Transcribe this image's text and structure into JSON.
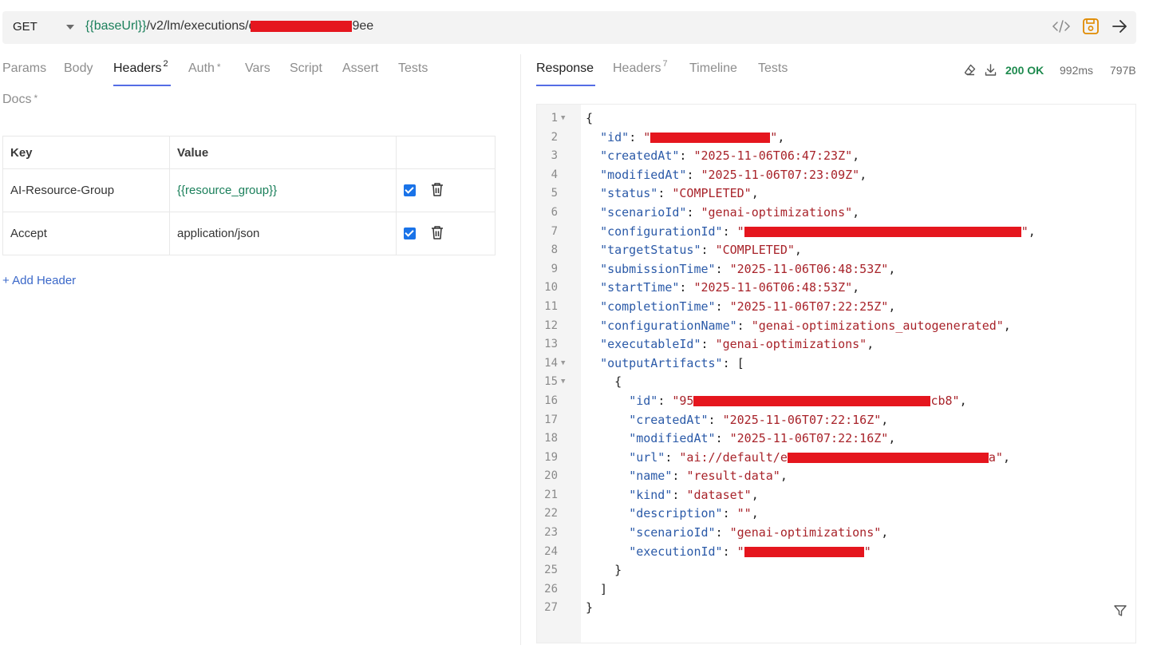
{
  "request": {
    "method": "GET",
    "url_var": "{{baseUrl}}",
    "url_path": "/v2/lm/executions/e",
    "url_suffix": "9ee"
  },
  "left_tabs": [
    {
      "label": "Params"
    },
    {
      "label": "Body"
    },
    {
      "label": "Headers",
      "count": "2",
      "active": true
    },
    {
      "label": "Auth",
      "marker": "*"
    },
    {
      "label": "Vars"
    },
    {
      "label": "Script"
    },
    {
      "label": "Assert"
    },
    {
      "label": "Tests"
    },
    {
      "label": "Docs",
      "marker": "*"
    }
  ],
  "headers_table": {
    "columns": [
      "Key",
      "Value",
      ""
    ],
    "rows": [
      {
        "key": "AI-Resource-Group",
        "value": "{{resource_group}}",
        "enabled": true
      },
      {
        "key": "Accept",
        "value": "application/json",
        "enabled": true
      }
    ],
    "add_label": "+ Add Header"
  },
  "response_tabs": [
    {
      "label": "Response",
      "active": true
    },
    {
      "label": "Headers",
      "count": "7"
    },
    {
      "label": "Timeline"
    },
    {
      "label": "Tests"
    }
  ],
  "response_meta": {
    "status": "200 OK",
    "time": "992ms",
    "size": "797B"
  },
  "response_lines": [
    {
      "n": "1",
      "fold": true,
      "parts": [
        [
          "p",
          "{"
        ]
      ]
    },
    {
      "n": "2",
      "parts": [
        [
          "p",
          "  "
        ],
        [
          "k",
          "\"id\""
        ],
        [
          "p",
          ": "
        ],
        [
          "s",
          "\""
        ],
        [
          "r",
          ""
        ],
        [
          "s",
          "\""
        ],
        [
          "p",
          ","
        ]
      ]
    },
    {
      "n": "3",
      "parts": [
        [
          "p",
          "  "
        ],
        [
          "k",
          "\"createdAt\""
        ],
        [
          "p",
          ": "
        ],
        [
          "s",
          "\"2025-11-06T06:47:23Z\""
        ],
        [
          "p",
          ","
        ]
      ]
    },
    {
      "n": "4",
      "parts": [
        [
          "p",
          "  "
        ],
        [
          "k",
          "\"modifiedAt\""
        ],
        [
          "p",
          ": "
        ],
        [
          "s",
          "\"2025-11-06T07:23:09Z\""
        ],
        [
          "p",
          ","
        ]
      ]
    },
    {
      "n": "5",
      "parts": [
        [
          "p",
          "  "
        ],
        [
          "k",
          "\"status\""
        ],
        [
          "p",
          ": "
        ],
        [
          "s",
          "\"COMPLETED\""
        ],
        [
          "p",
          ","
        ]
      ]
    },
    {
      "n": "6",
      "parts": [
        [
          "p",
          "  "
        ],
        [
          "k",
          "\"scenarioId\""
        ],
        [
          "p",
          ": "
        ],
        [
          "s",
          "\"genai-optimizations\""
        ],
        [
          "p",
          ","
        ]
      ]
    },
    {
      "n": "7",
      "parts": [
        [
          "p",
          "  "
        ],
        [
          "k",
          "\"configurationId\""
        ],
        [
          "p",
          ": "
        ],
        [
          "s",
          "\""
        ],
        [
          "r",
          ""
        ],
        [
          "s",
          "\""
        ],
        [
          "p",
          ","
        ]
      ]
    },
    {
      "n": "8",
      "parts": [
        [
          "p",
          "  "
        ],
        [
          "k",
          "\"targetStatus\""
        ],
        [
          "p",
          ": "
        ],
        [
          "s",
          "\"COMPLETED\""
        ],
        [
          "p",
          ","
        ]
      ]
    },
    {
      "n": "9",
      "parts": [
        [
          "p",
          "  "
        ],
        [
          "k",
          "\"submissionTime\""
        ],
        [
          "p",
          ": "
        ],
        [
          "s",
          "\"2025-11-06T06:48:53Z\""
        ],
        [
          "p",
          ","
        ]
      ]
    },
    {
      "n": "10",
      "parts": [
        [
          "p",
          "  "
        ],
        [
          "k",
          "\"startTime\""
        ],
        [
          "p",
          ": "
        ],
        [
          "s",
          "\"2025-11-06T06:48:53Z\""
        ],
        [
          "p",
          ","
        ]
      ]
    },
    {
      "n": "11",
      "parts": [
        [
          "p",
          "  "
        ],
        [
          "k",
          "\"completionTime\""
        ],
        [
          "p",
          ": "
        ],
        [
          "s",
          "\"2025-11-06T07:22:25Z\""
        ],
        [
          "p",
          ","
        ]
      ]
    },
    {
      "n": "12",
      "parts": [
        [
          "p",
          "  "
        ],
        [
          "k",
          "\"configurationName\""
        ],
        [
          "p",
          ": "
        ],
        [
          "s",
          "\"genai-optimizations_autogenerated\""
        ],
        [
          "p",
          ","
        ]
      ]
    },
    {
      "n": "13",
      "parts": [
        [
          "p",
          "  "
        ],
        [
          "k",
          "\"executableId\""
        ],
        [
          "p",
          ": "
        ],
        [
          "s",
          "\"genai-optimizations\""
        ],
        [
          "p",
          ","
        ]
      ]
    },
    {
      "n": "14",
      "fold": true,
      "parts": [
        [
          "p",
          "  "
        ],
        [
          "k",
          "\"outputArtifacts\""
        ],
        [
          "p",
          ": ["
        ]
      ]
    },
    {
      "n": "15",
      "fold": true,
      "parts": [
        [
          "p",
          "    {"
        ]
      ]
    },
    {
      "n": "16",
      "parts": [
        [
          "p",
          "      "
        ],
        [
          "k",
          "\"id\""
        ],
        [
          "p",
          ": "
        ],
        [
          "s",
          "\"95"
        ],
        [
          "r",
          ""
        ],
        [
          "s",
          "cb8\""
        ],
        [
          "p",
          ","
        ]
      ]
    },
    {
      "n": "17",
      "parts": [
        [
          "p",
          "      "
        ],
        [
          "k",
          "\"createdAt\""
        ],
        [
          "p",
          ": "
        ],
        [
          "s",
          "\"2025-11-06T07:22:16Z\""
        ],
        [
          "p",
          ","
        ]
      ]
    },
    {
      "n": "18",
      "parts": [
        [
          "p",
          "      "
        ],
        [
          "k",
          "\"modifiedAt\""
        ],
        [
          "p",
          ": "
        ],
        [
          "s",
          "\"2025-11-06T07:22:16Z\""
        ],
        [
          "p",
          ","
        ]
      ]
    },
    {
      "n": "19",
      "parts": [
        [
          "p",
          "      "
        ],
        [
          "k",
          "\"url\""
        ],
        [
          "p",
          ": "
        ],
        [
          "s",
          "\"ai://default/e"
        ],
        [
          "r",
          ""
        ],
        [
          "s",
          "a\""
        ],
        [
          "p",
          ","
        ]
      ]
    },
    {
      "n": "20",
      "parts": [
        [
          "p",
          "      "
        ],
        [
          "k",
          "\"name\""
        ],
        [
          "p",
          ": "
        ],
        [
          "s",
          "\"result-data\""
        ],
        [
          "p",
          ","
        ]
      ]
    },
    {
      "n": "21",
      "parts": [
        [
          "p",
          "      "
        ],
        [
          "k",
          "\"kind\""
        ],
        [
          "p",
          ": "
        ],
        [
          "s",
          "\"dataset\""
        ],
        [
          "p",
          ","
        ]
      ]
    },
    {
      "n": "22",
      "parts": [
        [
          "p",
          "      "
        ],
        [
          "k",
          "\"description\""
        ],
        [
          "p",
          ": "
        ],
        [
          "s",
          "\"\""
        ],
        [
          "p",
          ","
        ]
      ]
    },
    {
      "n": "23",
      "parts": [
        [
          "p",
          "      "
        ],
        [
          "k",
          "\"scenarioId\""
        ],
        [
          "p",
          ": "
        ],
        [
          "s",
          "\"genai-optimizations\""
        ],
        [
          "p",
          ","
        ]
      ]
    },
    {
      "n": "24",
      "parts": [
        [
          "p",
          "      "
        ],
        [
          "k",
          "\"executionId\""
        ],
        [
          "p",
          ": "
        ],
        [
          "s",
          "\""
        ],
        [
          "r",
          ""
        ],
        [
          "s",
          "\""
        ]
      ]
    },
    {
      "n": "25",
      "parts": [
        [
          "p",
          "    }"
        ]
      ]
    },
    {
      "n": "26",
      "parts": [
        [
          "p",
          "  ]"
        ]
      ]
    },
    {
      "n": "27",
      "parts": [
        [
          "p",
          "}"
        ]
      ]
    }
  ],
  "icons": {
    "code": "code-icon",
    "save": "save-icon",
    "send": "send-arrow-icon",
    "clear": "eraser-icon",
    "download": "download-icon",
    "filter": "filter-icon",
    "delete": "trash-icon"
  },
  "colors": {
    "accent": "#546de5",
    "save_icon": "#e08a00",
    "status_ok": "#1e8a4e",
    "variable": "#1a7f5a",
    "json_key": "#2b5aa8",
    "json_string": "#a8232a",
    "redaction": "#e5161e"
  }
}
